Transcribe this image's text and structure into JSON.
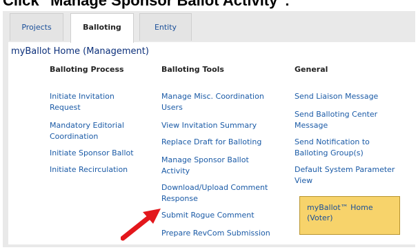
{
  "caption": "Click \"Manage Sponsor Ballot Activity\":",
  "tabs": [
    {
      "label": "Projects"
    },
    {
      "label": "Balloting"
    },
    {
      "label": "Entity"
    }
  ],
  "page_title": "myBallot Home (Management)",
  "columns": {
    "process": {
      "heading": "Balloting Process",
      "links": [
        "Initiate Invitation Request",
        "Mandatory Editorial Coordination",
        "Initiate Sponsor Ballot",
        "Initiate Recirculation"
      ]
    },
    "tools": {
      "heading": "Balloting Tools",
      "links": [
        "Manage Misc. Coordination Users",
        "View Invitation Summary",
        "Replace Draft for Balloting",
        "Manage Sponsor Ballot Activity",
        "Download/Upload Comment Response",
        "Submit Rogue Comment",
        "Prepare RevCom Submission"
      ]
    },
    "general": {
      "heading": "General",
      "links": [
        "Send Liaison Message",
        "Send Balloting Center Message",
        "Send Notification to Balloting Group(s)",
        "Default System Parameter View"
      ]
    }
  },
  "voter_box": "myBallot™ Home (Voter)",
  "colors": {
    "link": "#1a5aa6",
    "arrow": "#e3171c",
    "voter_box": "#f7d36b"
  },
  "icons": [
    "red-arrow-icon"
  ]
}
